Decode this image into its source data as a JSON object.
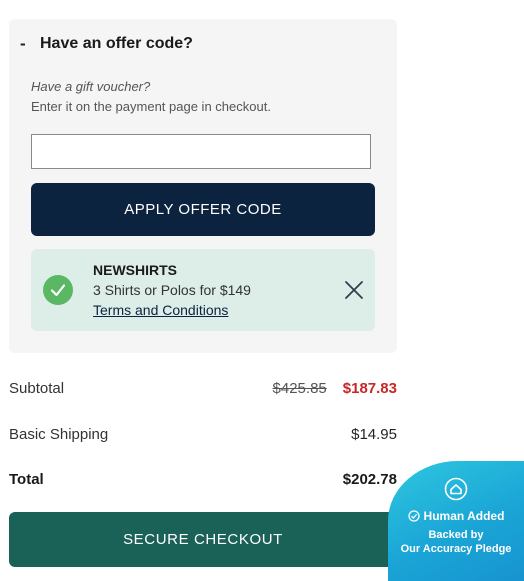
{
  "offer": {
    "collapse_symbol": "-",
    "title": "Have an offer code?",
    "voucher_hint": "Have a gift voucher?",
    "voucher_sub": "Enter it on the payment page in checkout.",
    "input_value": "",
    "input_placeholder": "",
    "apply_label": "APPLY OFFER CODE",
    "applied": {
      "code": "NEWSHIRTS",
      "description": "3 Shirts or Polos for $149",
      "terms_link": "Terms and Conditions",
      "status_icon": "check-circle-icon",
      "remove_icon": "close-icon"
    }
  },
  "summary": {
    "subtotal_label": "Subtotal",
    "subtotal_original": "$425.85",
    "subtotal_discounted": "$187.83",
    "shipping_label": "Basic Shipping",
    "shipping_value": "$14.95",
    "total_label": "Total",
    "total_value": "$202.78"
  },
  "checkout": {
    "label": "SECURE CHECKOUT"
  },
  "badge": {
    "title": "Human Added",
    "line1": "Backed by",
    "line2": "Our Accuracy Pledge"
  },
  "colors": {
    "apply_button": "#0c2340",
    "checkout_button": "#1a6158",
    "discount_price": "#c62828",
    "applied_bg": "#ddeee8",
    "check_green": "#5ab864",
    "badge_blue": "#1aa5d6"
  }
}
